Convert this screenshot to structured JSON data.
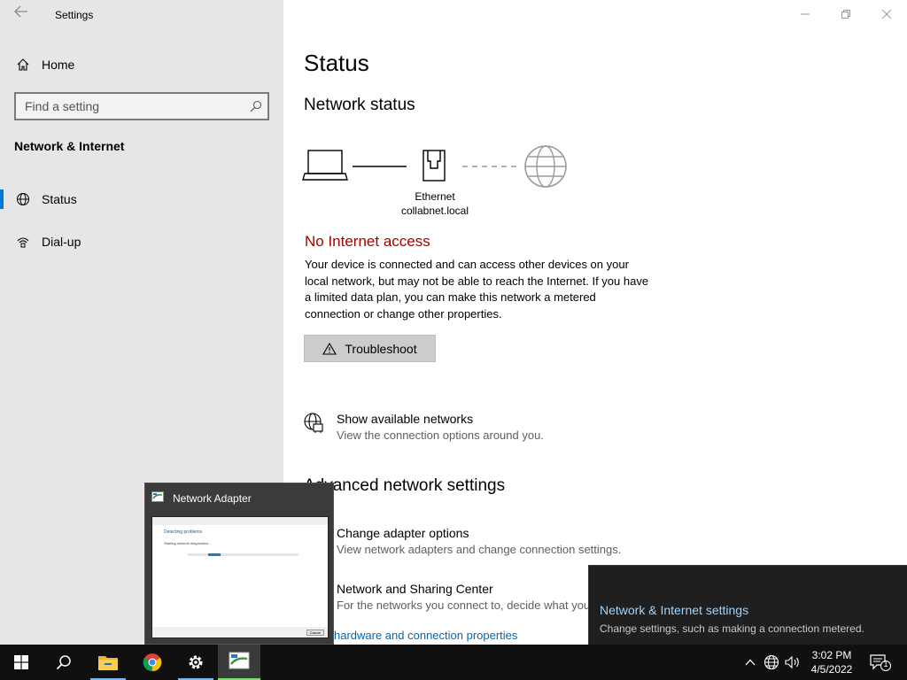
{
  "window": {
    "title": "Settings",
    "back_icon": "back-arrow-icon",
    "controls": {
      "minimize": "minimize-icon",
      "restore": "restore-icon",
      "close": "close-icon"
    }
  },
  "sidebar": {
    "home_label": "Home",
    "search_placeholder": "Find a setting",
    "section_heading": "Network & Internet",
    "items": [
      {
        "label": "Status",
        "icon": "globe-status-icon",
        "selected": true
      },
      {
        "label": "Dial-up",
        "icon": "dialup-icon",
        "selected": false
      }
    ],
    "accent_color": "#0078d7"
  },
  "main": {
    "title": "Status",
    "network_status_heading": "Network status",
    "diagram": {
      "device_icon": "laptop-icon",
      "adapter_icon": "ethernet-icon",
      "internet_icon": "globe-icon",
      "adapter_name": "Ethernet",
      "network_name": "collabnet.local"
    },
    "alert_title": "No Internet access",
    "alert_color": "#a80000",
    "description": "Your device is connected and can access other devices on your local network, but may not be able to reach the Internet. If you have a limited data plan, you can make this network a metered connection or change other properties.",
    "troubleshoot_label": "Troubleshoot",
    "show_networks": {
      "title": "Show available networks",
      "subtitle": "View the connection options around you."
    },
    "advanced_heading": "Advanced network settings",
    "change_adapter": {
      "title": "Change adapter options",
      "subtitle": "View network adapters and change connection settings."
    },
    "sharing_center": {
      "title": "Network and Sharing Center",
      "subtitle": "For the networks you connect to, decide what you"
    },
    "hardware_link": "hardware and connection properties"
  },
  "preview": {
    "title": "Network Adapter",
    "thumb_detecting": "Detecting problems",
    "thumb_starting": "Starting network diagnostics...",
    "thumb_cancel": "Cancel",
    "progress": 0.25
  },
  "flyout": {
    "title": "Network & Internet settings",
    "description": "Change settings, such as making a connection metered."
  },
  "taskbar": {
    "apps": [
      "start-icon",
      "search-icon",
      "file-explorer-icon",
      "chrome-icon",
      "settings-gear-icon",
      "network-adapter-icon"
    ],
    "tray": [
      "chevron-up-icon",
      "network-globe-icon",
      "volume-icon",
      "notification-icon"
    ],
    "time": "3:02 PM",
    "date": "4/5/2022",
    "notification_count": "1"
  }
}
